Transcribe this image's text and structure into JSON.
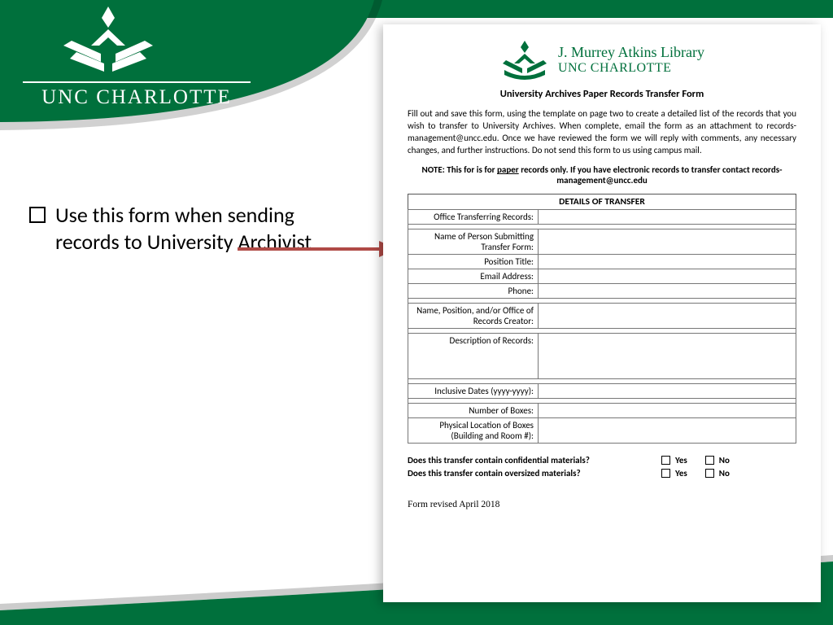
{
  "brand": {
    "name": "UNC CHARLOTTE"
  },
  "bullet": {
    "text": "Use this form when sending records to University Archivist"
  },
  "doc": {
    "library_line1": "J. Murrey Atkins Library",
    "library_line2": "UNC CHARLOTTE",
    "title": "University Archives Paper Records Transfer Form",
    "intro": "Fill out and save this form, using the template on page two to create a detailed list of the records that you wish to transfer to University Archives. When complete, email the form as an attachment to records-management@uncc.edu. Once we have reviewed the form we will reply with comments, any necessary changes, and further instructions. Do not send this form to us using campus mail.",
    "note_prefix": "NOTE: This for is for ",
    "note_underlined": "paper",
    "note_suffix": " records only. If you have electronic records to transfer contact records-management@uncc.edu",
    "details_header": "DETAILS OF TRANSFER",
    "fields": {
      "office": "Office Transferring Records:",
      "name": "Name of Person Submitting Transfer Form:",
      "position": "Position Title:",
      "email": "Email Address:",
      "phone": "Phone:",
      "creator": "Name, Position, and/or Office of Records Creator:",
      "description": "Description of Records:",
      "dates": "Inclusive Dates (yyyy-yyyy):",
      "boxes": "Number of Boxes:",
      "location": "Physical Location of Boxes (Building and Room #):"
    },
    "q1": "Does this transfer contain confidential materials?",
    "q2": "Does this transfer contain oversized materials?",
    "yes": "Yes",
    "no": "No",
    "revised": "Form revised April 2018"
  }
}
